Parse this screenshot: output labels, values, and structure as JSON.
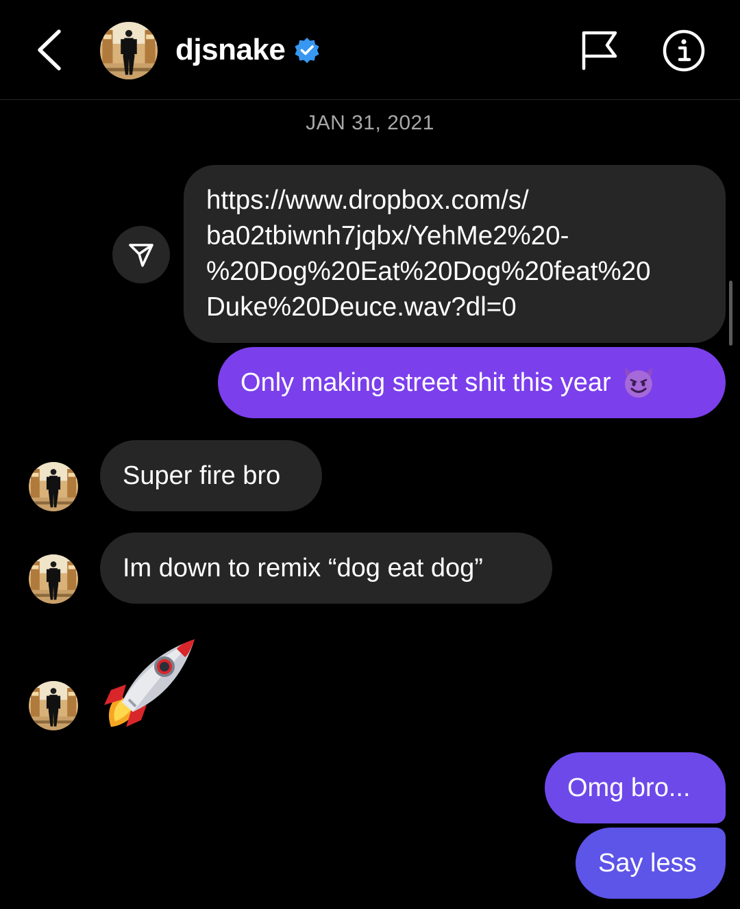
{
  "header": {
    "username": "djsnake",
    "verified": true,
    "icons": [
      "back-chevron-icon",
      "verified-badge-icon",
      "flag-icon",
      "info-icon"
    ]
  },
  "thread": {
    "date_divider": "JAN 31, 2021",
    "messages": [
      {
        "sender": "me",
        "type": "link",
        "text_lines": [
          "https://www.dropbox.com/s/",
          "ba02tbiwnh7jqbx/YehMe2%20-",
          "%20Dog%20Eat%20Dog%20feat%20",
          "Duke%20Deuce.wav?dl=0"
        ]
      },
      {
        "sender": "me",
        "type": "text",
        "text": "Only making street shit this year",
        "emoji": "smiling-devil"
      },
      {
        "sender": "djsnake",
        "type": "text",
        "text": "Super fire bro"
      },
      {
        "sender": "djsnake",
        "type": "text",
        "text": "Im down to remix “dog eat dog”"
      },
      {
        "sender": "djsnake",
        "type": "emoji",
        "emoji": "rocket"
      },
      {
        "sender": "me",
        "type": "text",
        "text": "Omg bro..."
      },
      {
        "sender": "me",
        "type": "text",
        "text": "Say less"
      }
    ]
  },
  "colors": {
    "background": "#000000",
    "incoming_bubble": "#262626",
    "outgoing_purple": "#7b3fec",
    "outgoing_violet": "#6d49ea",
    "outgoing_indigo": "#5d54e8",
    "verified_blue": "#3897f0",
    "muted_text": "#a8a8a8"
  }
}
